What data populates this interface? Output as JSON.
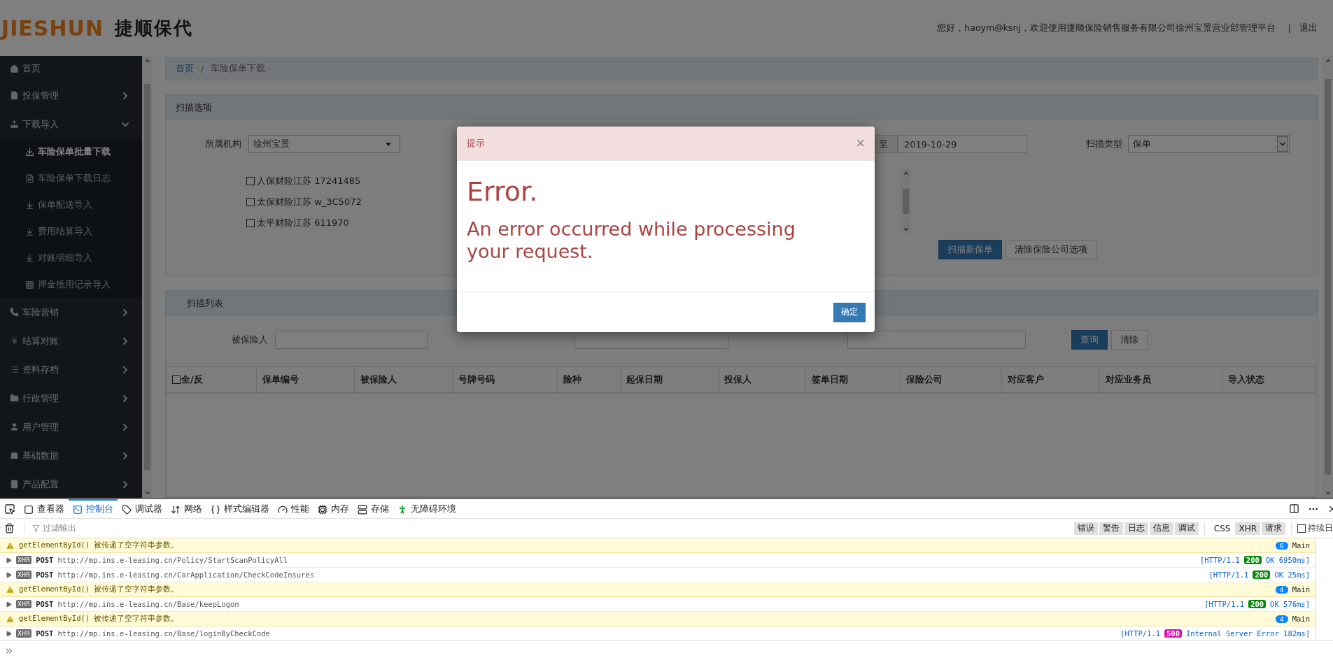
{
  "header": {
    "logo_mark": "JIESHUN",
    "logo_text": "捷顺保代",
    "greeting": "您好，haoym@ksnj，欢迎使用捷顺保险销售服务有限公司徐州宝景营业部管理平台",
    "separator": "|",
    "logout": "退出"
  },
  "sidebar": {
    "items": [
      {
        "label": "首页",
        "kind": "link",
        "selected": false
      },
      {
        "label": "投保管理",
        "kind": "group",
        "expanded": false
      },
      {
        "label": "下载导入",
        "kind": "group",
        "expanded": true,
        "children": [
          {
            "label": "车险保单批量下载",
            "selected": true
          },
          {
            "label": "车险保单下载日志",
            "selected": false
          },
          {
            "label": "保单配送导入",
            "selected": false
          },
          {
            "label": "费用结算导入",
            "selected": false
          },
          {
            "label": "对账明细导入",
            "selected": false
          },
          {
            "label": "押金抵用记录导入",
            "selected": false
          }
        ]
      },
      {
        "label": "车险营销",
        "kind": "group",
        "expanded": false
      },
      {
        "label": "结算对账",
        "kind": "group",
        "expanded": false
      },
      {
        "label": "资料存档",
        "kind": "group",
        "expanded": false
      },
      {
        "label": "行政管理",
        "kind": "group",
        "expanded": false
      },
      {
        "label": "用户管理",
        "kind": "group",
        "expanded": false
      },
      {
        "label": "基础数据",
        "kind": "group",
        "expanded": false
      },
      {
        "label": "产品配置",
        "kind": "group",
        "expanded": false
      }
    ]
  },
  "breadcrumb": [
    {
      "label": "首页",
      "kind": "link"
    },
    {
      "label": "/",
      "kind": "separator"
    },
    {
      "label": "车险保单下载",
      "kind": "current"
    }
  ],
  "scan_panel": {
    "title": "扫描选项",
    "org_label": "所属机构",
    "org_value": "徐州宝景",
    "date_sep": "至",
    "date_end": "2019-10-29",
    "type_label": "扫描类型",
    "type_value": "保单",
    "companies": [
      {
        "label": "人保财险江苏 17241485",
        "checked": false
      },
      {
        "label": "太保财险江苏 w_3C5072",
        "checked": false
      },
      {
        "label": "太平财险江苏 611970",
        "checked": false
      }
    ],
    "buttons": [
      {
        "label": "扫描新保单",
        "kind": "primary"
      },
      {
        "label": "清除保险公司选项",
        "kind": "default"
      }
    ]
  },
  "list_panel": {
    "title": "扫描列表",
    "insured_label": "被保险人",
    "buttons": [
      {
        "label": "查询",
        "kind": "primary"
      },
      {
        "label": "清除",
        "kind": "default"
      }
    ]
  },
  "table": {
    "select_all": {
      "label": "全/反",
      "checked": false
    },
    "columns": [
      "保单编号",
      "被保险人",
      "号牌号码",
      "险种",
      "起保日期",
      "投保人",
      "签单日期",
      "保险公司",
      "对应客户",
      "对应业务员",
      "导入状态"
    ]
  },
  "modal": {
    "title": "提示",
    "close": "×",
    "heading": "Error.",
    "message": "An error occurred while processing your request.",
    "ok": "确定"
  },
  "devtools": {
    "tabs": [
      {
        "label": "查看器",
        "selected": false
      },
      {
        "label": "控制台",
        "selected": true
      },
      {
        "label": "调试器",
        "selected": false
      },
      {
        "label": "网络",
        "selected": false
      },
      {
        "label": "样式编辑器",
        "selected": false
      },
      {
        "label": "性能",
        "selected": false
      },
      {
        "label": "内存",
        "selected": false
      },
      {
        "label": "存储",
        "selected": false
      },
      {
        "label": "无障碍环境",
        "selected": false
      }
    ],
    "filter_placeholder": "过滤输出",
    "levels": [
      {
        "label": "错误",
        "selected": true
      },
      {
        "label": "警告",
        "selected": true
      },
      {
        "label": "日志",
        "selected": true
      },
      {
        "label": "信息",
        "selected": true
      },
      {
        "label": "调试",
        "selected": true
      }
    ],
    "types": [
      {
        "label": "CSS",
        "selected": false
      },
      {
        "label": "XHR",
        "selected": true
      },
      {
        "label": "请求",
        "selected": true
      }
    ],
    "persist": {
      "label": "持续日",
      "checked": false
    },
    "rows": [
      {
        "kind": "warning",
        "message": "getElementById() 被传递了空字符串参数。",
        "count": "6",
        "source": "Main"
      },
      {
        "kind": "xhr",
        "tag": "XHR",
        "method": "POST",
        "url": "http://mp.ins.e-leasing.cn/Policy/StartScanPolicyAll",
        "protocol": "[HTTP/1.1",
        "status": "200",
        "color": "#0a8a0a",
        "result": "OK 6950ms]"
      },
      {
        "kind": "xhr",
        "tag": "XHR",
        "method": "POST",
        "url": "http://mp.ins.e-leasing.cn/CarApplication/CheckCodeInsures",
        "protocol": "[HTTP/1.1",
        "status": "200",
        "color": "#0a8a0a",
        "result": "OK 25ms]"
      },
      {
        "kind": "warning",
        "message": "getElementById() 被传递了空字符串参数。",
        "count": "4",
        "source": "Main"
      },
      {
        "kind": "xhr",
        "tag": "XHR",
        "method": "POST",
        "url": "http://mp.ins.e-leasing.cn/Base/keepLogon",
        "protocol": "[HTTP/1.1",
        "status": "200",
        "color": "#0a8a0a",
        "result": "OK 576ms]"
      },
      {
        "kind": "warning",
        "message": "getElementById() 被传递了空字符串参数。",
        "count": "4",
        "source": "Main"
      },
      {
        "kind": "xhr",
        "tag": "XHR",
        "method": "POST",
        "url": "http://mp.ins.e-leasing.cn/Base/loginByCheckCode",
        "protocol": "[HTTP/1.1",
        "status": "500",
        "color": "#dd10a8",
        "result": "Internal Server Error 182ms]"
      }
    ]
  }
}
